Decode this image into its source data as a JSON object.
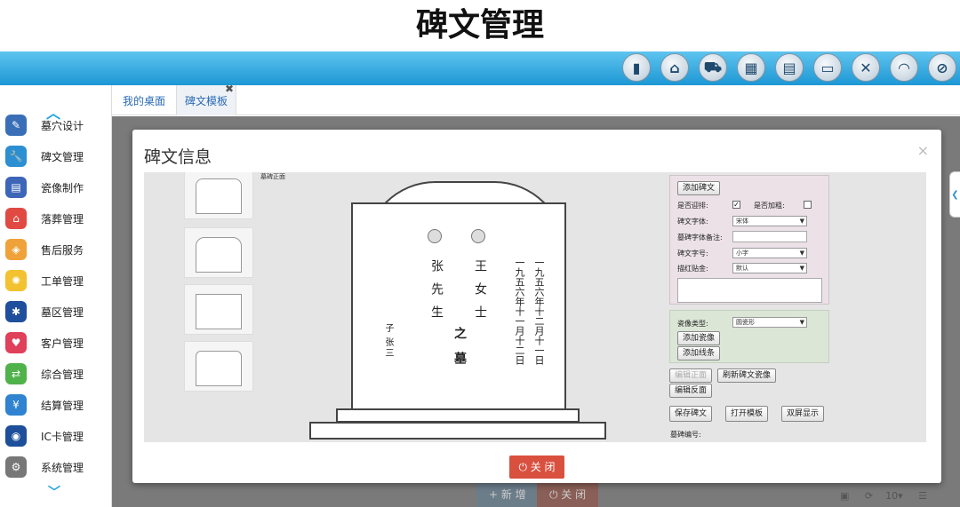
{
  "page_title": "碑文管理",
  "topbar_icons": [
    "chart-icon",
    "home-icon",
    "cart-icon",
    "building-icon",
    "clipboard-icon",
    "monitor-icon",
    "close-icon",
    "rss-icon",
    "block-icon"
  ],
  "sidebar": {
    "items": [
      {
        "label": "墓穴设计",
        "icon": "pencil-icon",
        "color": "#3a6fb8"
      },
      {
        "label": "碑文管理",
        "icon": "wrench-icon",
        "color": "#2c8fd1"
      },
      {
        "label": "瓷像制作",
        "icon": "pages-icon",
        "color": "#3d66b8"
      },
      {
        "label": "落葬管理",
        "icon": "house-icon",
        "color": "#e04a42"
      },
      {
        "label": "售后服务",
        "icon": "bag-icon",
        "color": "#f0a23a"
      },
      {
        "label": "工单管理",
        "icon": "bulb-icon",
        "color": "#f2c230"
      },
      {
        "label": "墓区管理",
        "icon": "network-icon",
        "color": "#1f4f9c"
      },
      {
        "label": "客户管理",
        "icon": "heart-icon",
        "color": "#e0405a"
      },
      {
        "label": "综合管理",
        "icon": "shuffle-icon",
        "color": "#4fb24a"
      },
      {
        "label": "结算管理",
        "icon": "yen-icon",
        "color": "#2f83d0"
      },
      {
        "label": "IC卡管理",
        "icon": "wifi-card-icon",
        "color": "#1d4f9a"
      },
      {
        "label": "系统管理",
        "icon": "gear-icon",
        "color": "#777777"
      }
    ]
  },
  "tabs": [
    {
      "label": "我的桌面"
    },
    {
      "label": "碑文模板"
    }
  ],
  "bottom_buttons": {
    "new": "+ 新 增",
    "close": "⏻ 关 闭"
  },
  "pagination": {
    "page_size": "10"
  },
  "modal": {
    "title": "碑文信息",
    "front_label": "墓碑正面",
    "inscription": {
      "left_name": "张先生",
      "right_name": "王女士",
      "tomb_of": "之墓",
      "date_left": "一九五六年十一月十二日",
      "date_right": "一九五六年十二月十一日",
      "son_label": "子",
      "son_name": "张三"
    },
    "form": {
      "add_inscription": "添加碑文",
      "is_traditional_label": "是否迎排:",
      "is_traditional_checked": true,
      "is_bold_label": "是否加粗:",
      "is_bold_checked": false,
      "font_label": "碑文字体:",
      "font_value": "宋体",
      "font_note_label": "墓碑字体备注:",
      "font_size_label": "碑文字号:",
      "font_size_value": "小字",
      "gilding_label": "描红贴金:",
      "gilding_value": "默认",
      "image_type_label": "瓷像类型:",
      "image_type_value": "圆瓷形",
      "add_image": "添加瓷像",
      "add_line": "添加线条",
      "edit_front": "编辑正面",
      "refresh_image": "刷新碑文瓷像",
      "edit_back": "编辑反面",
      "save": "保存碑文",
      "open_template": "打开模板",
      "dual_screen": "双屏显示",
      "tomb_number_label": "墓碑编号:"
    },
    "close_button": "⏻ 关 闭"
  }
}
